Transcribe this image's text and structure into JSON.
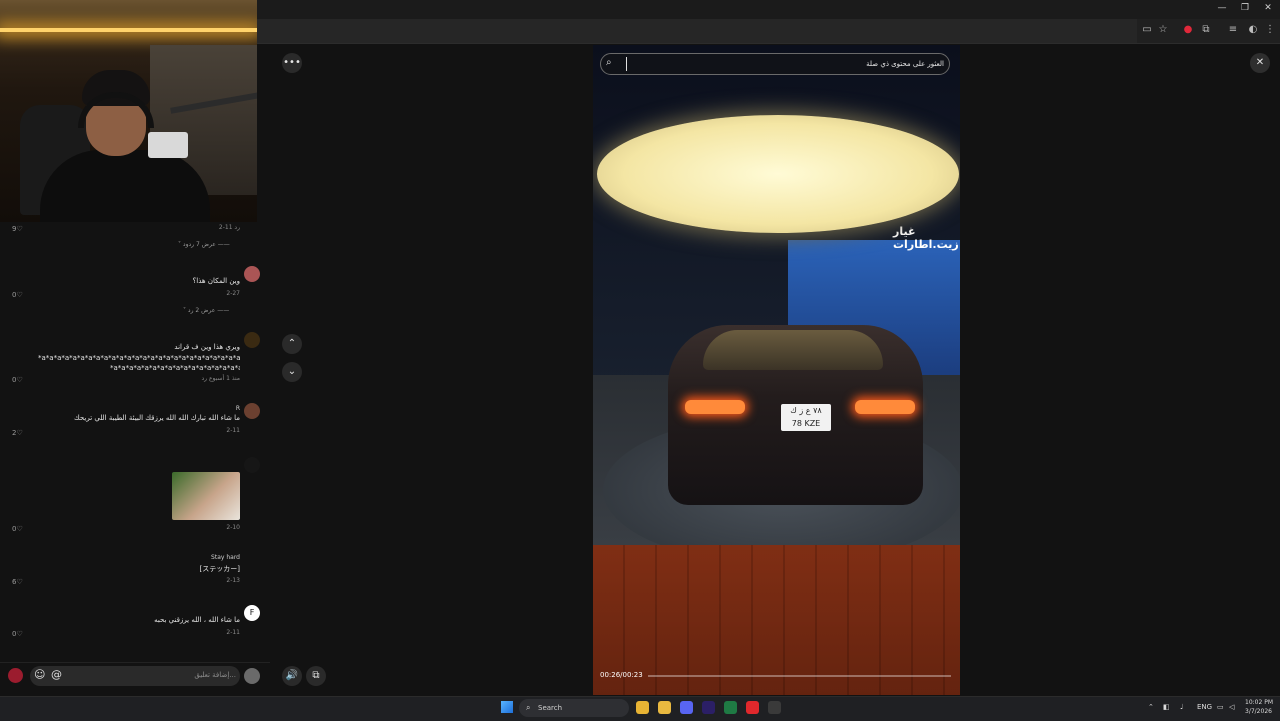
{
  "window": {
    "minimize_label": "—",
    "restore_label": "❐",
    "close_label": "✕"
  },
  "toolbar_icons": [
    "screen-cast-icon",
    "bookmark-star-icon",
    "record-icon",
    "extensions-icon",
    "playlist-icon",
    "profile-icon",
    "browser-menu-icon"
  ],
  "video": {
    "search_placeholder": "العثور على محتوى ذي صلة",
    "shop_sign": "غيار زيت.اطارات",
    "plate_line1": "٧٨ ع ز ك",
    "plate_line2": "78  KZE",
    "time": "00:26/00:23",
    "progress_fraction": 0.0,
    "close_label": "✕",
    "more_label": "•••"
  },
  "nav": {
    "up_label": "⌃",
    "down_label": "⌄"
  },
  "comments": [
    {
      "id": "c0",
      "text": "",
      "meta": "2-11   رد",
      "likes": "9"
    },
    {
      "id": "r0",
      "replies": "عرض 7 ردود"
    },
    {
      "id": "c1",
      "user": "..",
      "text": "وين المكان هذا؟",
      "meta": "2-27",
      "meta2": "رد",
      "likes": "0"
    },
    {
      "id": "r1",
      "replies": "عرض 2 رد"
    },
    {
      "id": "c2",
      "user": "",
      "text": "ويري هذا وين ف قراند",
      "text2": "*a*a*a*a*a*a*a*a*a*a*a*a*a*a*a*a*a*a*a*a*a*a*a*a*a*a*a*a*a*a*a*a*a*a*a*a*a*a*a*a*a*a*a*a*a*a*a*a*a*a*a*a*a*a*a*a*a*",
      "text3": "*a*a*a*a*a*a*a*a*a*a*a*a*a*a*a*a*a*a*a*a*a*a*a*a*a*a*a*a*a*a*a*a*a*a*a*a*a*a*a*a*a*a*a*a*a*a*a*a*",
      "meta": "منذ 1 أسبوع   رد",
      "likes": "0"
    },
    {
      "id": "c3",
      "user": "R",
      "text": "ما شاء الله تبارك الله الله يرزقك البيئة الطيبة اللي تريحك",
      "meta": "2-11",
      "meta2": "رد",
      "likes": "2"
    },
    {
      "id": "c4",
      "user": "",
      "text": "",
      "meta": "2-10",
      "meta2": "رد",
      "likes": "0"
    },
    {
      "id": "c5",
      "user": "Stay hard",
      "text": "[ステッカー]",
      "meta": "2-13",
      "meta2": "رد",
      "likes": "6"
    },
    {
      "id": "c6",
      "user": "F",
      "text": "ما شاء الله ، الله يرزقني بحبه",
      "meta": "2-11",
      "meta2": "رد",
      "likes": "0"
    }
  ],
  "comment_input": {
    "placeholder": "إضافة تعليق...",
    "at_label": "@",
    "emoji_label": "☺"
  },
  "side_controls": {
    "volume_label": "🔊",
    "copy_label": "⧉"
  },
  "taskbar": {
    "search_label": "Search",
    "language": "ENG",
    "time": "10:02 PM",
    "date": "3/7/2026",
    "apps": [
      "chrome-icon",
      "file-explorer-icon",
      "discord-icon",
      "premiere-icon",
      "excel-icon",
      "red-app-icon",
      "steam-icon"
    ],
    "app_colors": [
      "#e7b334",
      "#e9b940",
      "#5865f2",
      "#2b1f66",
      "#1f7a44",
      "#e0282c",
      "#3a3a3a"
    ]
  }
}
